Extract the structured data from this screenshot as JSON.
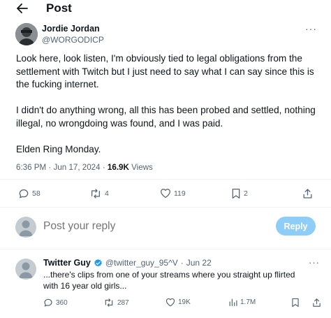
{
  "header": {
    "title": "Post",
    "back_icon": "arrow-left-icon"
  },
  "author": {
    "name": "Jordie Jordan",
    "handle": "@WORGODICP",
    "more": "···"
  },
  "tweet": {
    "paragraphs": [
      "Look here, look listen, I'm obviously tied to legal obligations from the settlement with Twitch but I just need to say what I can say since this is the fucking internet.",
      "I didn't do anything wrong, all this has been probed and settled, nothing illegal, no wrongdoing was found, and I was paid.",
      "Elden Ring Monday."
    ],
    "time": "6:36 PM",
    "date": "Jun 17, 2024",
    "separator": "·",
    "views_count": "16.9K",
    "views_label": "Views"
  },
  "actions": {
    "replies": "58",
    "reposts": "4",
    "likes": "119",
    "bookmarks": "2"
  },
  "reply_box": {
    "placeholder": "Post your reply",
    "button_label": "Reply"
  },
  "reply": {
    "name": "Twitter Guy",
    "handle": "@twitter_guy_95^V",
    "separator": "·",
    "date": "Jun 22",
    "text": "...there's clips from one of your streams where you straight up flirted with 16 year old girls...",
    "more": "···",
    "replies": "360",
    "reposts": "287",
    "likes": "19K",
    "views": "1.7M"
  },
  "colors": {
    "accent": "#1d9bf0",
    "reply_button": "#8ecdf8",
    "muted": "#536471",
    "text": "#0f1419"
  }
}
